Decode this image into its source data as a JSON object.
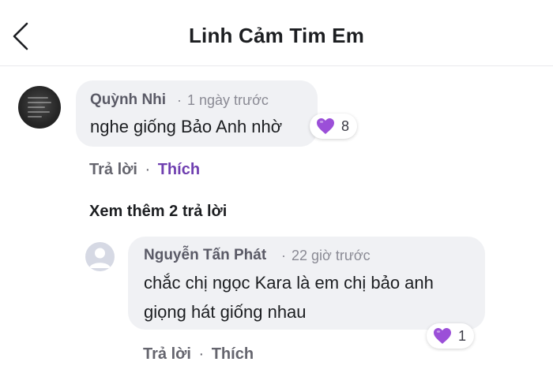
{
  "header": {
    "title": "Linh Cảm Tim Em"
  },
  "comments": [
    {
      "author": "Quỳnh Nhi",
      "separator": "·",
      "time": "1 ngày trước",
      "text": "nghe giống Bảo Anh nhờ",
      "reaction": {
        "icon": "purple-heart-icon",
        "count": "8"
      },
      "actions": {
        "reply": "Trả lời",
        "dot": "·",
        "like": "Thích"
      }
    }
  ],
  "more_replies": "Xem thêm 2 trả lời",
  "reply": {
    "author": "Nguyễn Tấn Phát",
    "separator": "·",
    "time": "22 giờ trước",
    "text_lines": [
      "chắc chị ngọc Kara là em chị bảo anh",
      "giọng hát giống nhau"
    ],
    "reaction": {
      "icon": "purple-heart-icon",
      "count": "1"
    },
    "actions": {
      "reply": "Trả lời",
      "dot": "·",
      "like": "Thích"
    }
  },
  "colors": {
    "like": "#6f3fb0",
    "heart": "#9b4fd8",
    "bubble": "#f0f1f4"
  }
}
